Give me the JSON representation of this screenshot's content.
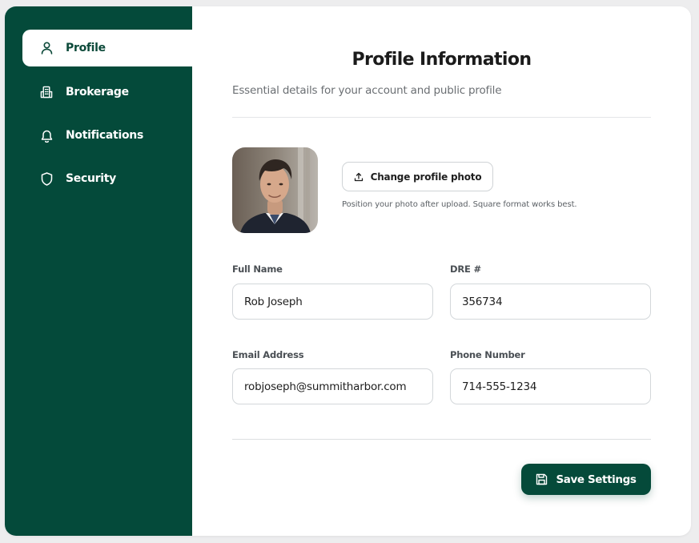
{
  "sidebar": {
    "items": [
      {
        "label": "Profile",
        "icon": "user-icon",
        "active": true
      },
      {
        "label": "Brokerage",
        "icon": "building-icon",
        "active": false
      },
      {
        "label": "Notifications",
        "icon": "bell-icon",
        "active": false
      },
      {
        "label": "Security",
        "icon": "shield-icon",
        "active": false
      }
    ]
  },
  "main": {
    "title": "Profile Information",
    "subtitle": "Essential details for your account and public profile",
    "photo": {
      "button_label": "Change profile photo",
      "button_icon": "upload-icon",
      "hint": "Position your photo after upload. Square format works best."
    },
    "fields": {
      "full_name": {
        "label": "Full Name",
        "value": "Rob Joseph"
      },
      "dre": {
        "label": "DRE #",
        "value": "356734"
      },
      "email": {
        "label": "Email Address",
        "value": "robjoseph@summitharbor.com"
      },
      "phone": {
        "label": "Phone Number",
        "value": "714-555-1234"
      }
    },
    "save_button": {
      "label": "Save Settings",
      "icon": "floppy-disk-icon"
    }
  },
  "colors": {
    "sidebar_bg": "#044a3a",
    "accent": "#054a3a",
    "page_bg": "#ededee"
  }
}
